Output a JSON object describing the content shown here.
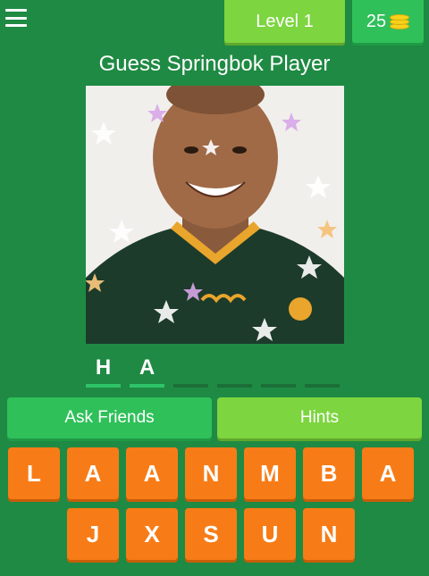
{
  "header": {
    "menu_icon": "hamburger-menu-icon",
    "level_label": "Level 1",
    "coins": "25",
    "coin_icon": "coin-stack-icon"
  },
  "title": "Guess Springbok Player",
  "answer_slots": [
    "H",
    "A",
    "",
    "",
    "",
    ""
  ],
  "actions": {
    "ask_friends": "Ask Friends",
    "hints": "Hints"
  },
  "keyboard": {
    "row1": [
      "L",
      "A",
      "A",
      "N",
      "M",
      "B",
      "A"
    ],
    "row2": [
      "J",
      "X",
      "S",
      "U",
      "N"
    ]
  },
  "colors": {
    "background": "#1f8a43",
    "level_button": "#7dd540",
    "coins_button": "#2fc05a",
    "key": "#f77c17"
  }
}
